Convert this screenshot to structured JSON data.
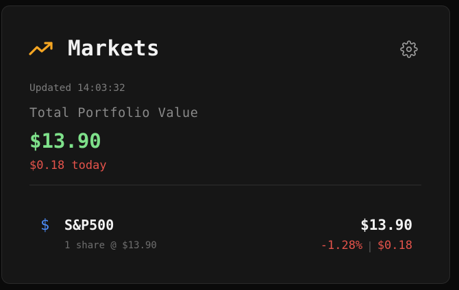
{
  "header": {
    "title": "Markets",
    "icon": "trending-up-icon",
    "accent": "#f5a623",
    "settings_icon": "gear-icon"
  },
  "summary": {
    "updated": "Updated 14:03:32",
    "label": "Total Portfolio Value",
    "value": "$13.90",
    "today": "$0.18 today",
    "positive_color": "#7ee08a",
    "negative_color": "#e5534b"
  },
  "holdings": [
    {
      "icon": "dollar-icon",
      "ticker": "S&P500",
      "shares": "1 share @ $13.90",
      "price": "$13.90",
      "percent_change": "-1.28%",
      "separator": "|",
      "amount_change": "$0.18"
    }
  ]
}
